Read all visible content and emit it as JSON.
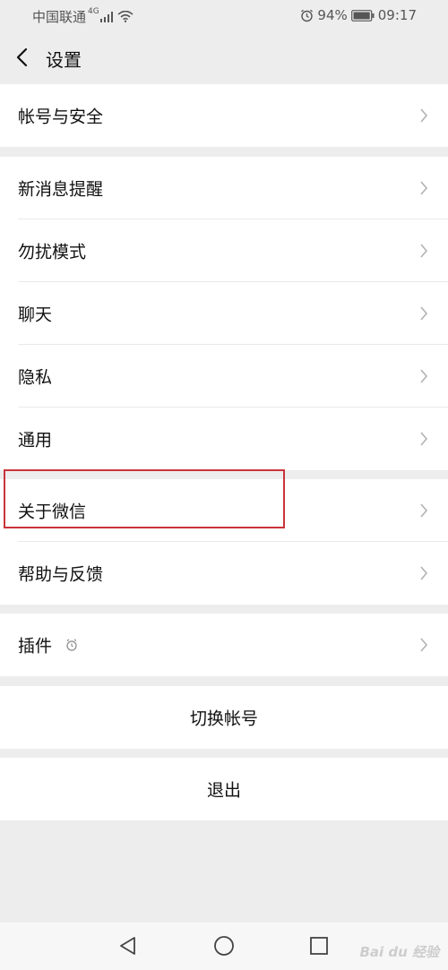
{
  "status_bar": {
    "carrier": "中国联通",
    "network_type": "4G",
    "battery_percent": "94%",
    "time": "09:17"
  },
  "header": {
    "title": "设置"
  },
  "groups": {
    "account": {
      "label": "帐号与安全"
    },
    "notifications": {
      "label": "新消息提醒"
    },
    "do_not_disturb": {
      "label": "勿扰模式"
    },
    "chat": {
      "label": "聊天"
    },
    "privacy": {
      "label": "隐私"
    },
    "general": {
      "label": "通用"
    },
    "about": {
      "label": "关于微信"
    },
    "help": {
      "label": "帮助与反馈"
    },
    "plugins": {
      "label": "插件"
    }
  },
  "actions": {
    "switch_account": "切换帐号",
    "logout": "退出"
  },
  "colors": {
    "background": "#ededed",
    "highlight": "#c9343b"
  },
  "icons": [
    "signal-icon",
    "wifi-icon",
    "alarm-icon",
    "battery-icon",
    "back-icon",
    "chevron-right-icon",
    "plugin-badge-icon",
    "nav-back-icon",
    "nav-home-icon",
    "nav-recent-icon"
  ]
}
